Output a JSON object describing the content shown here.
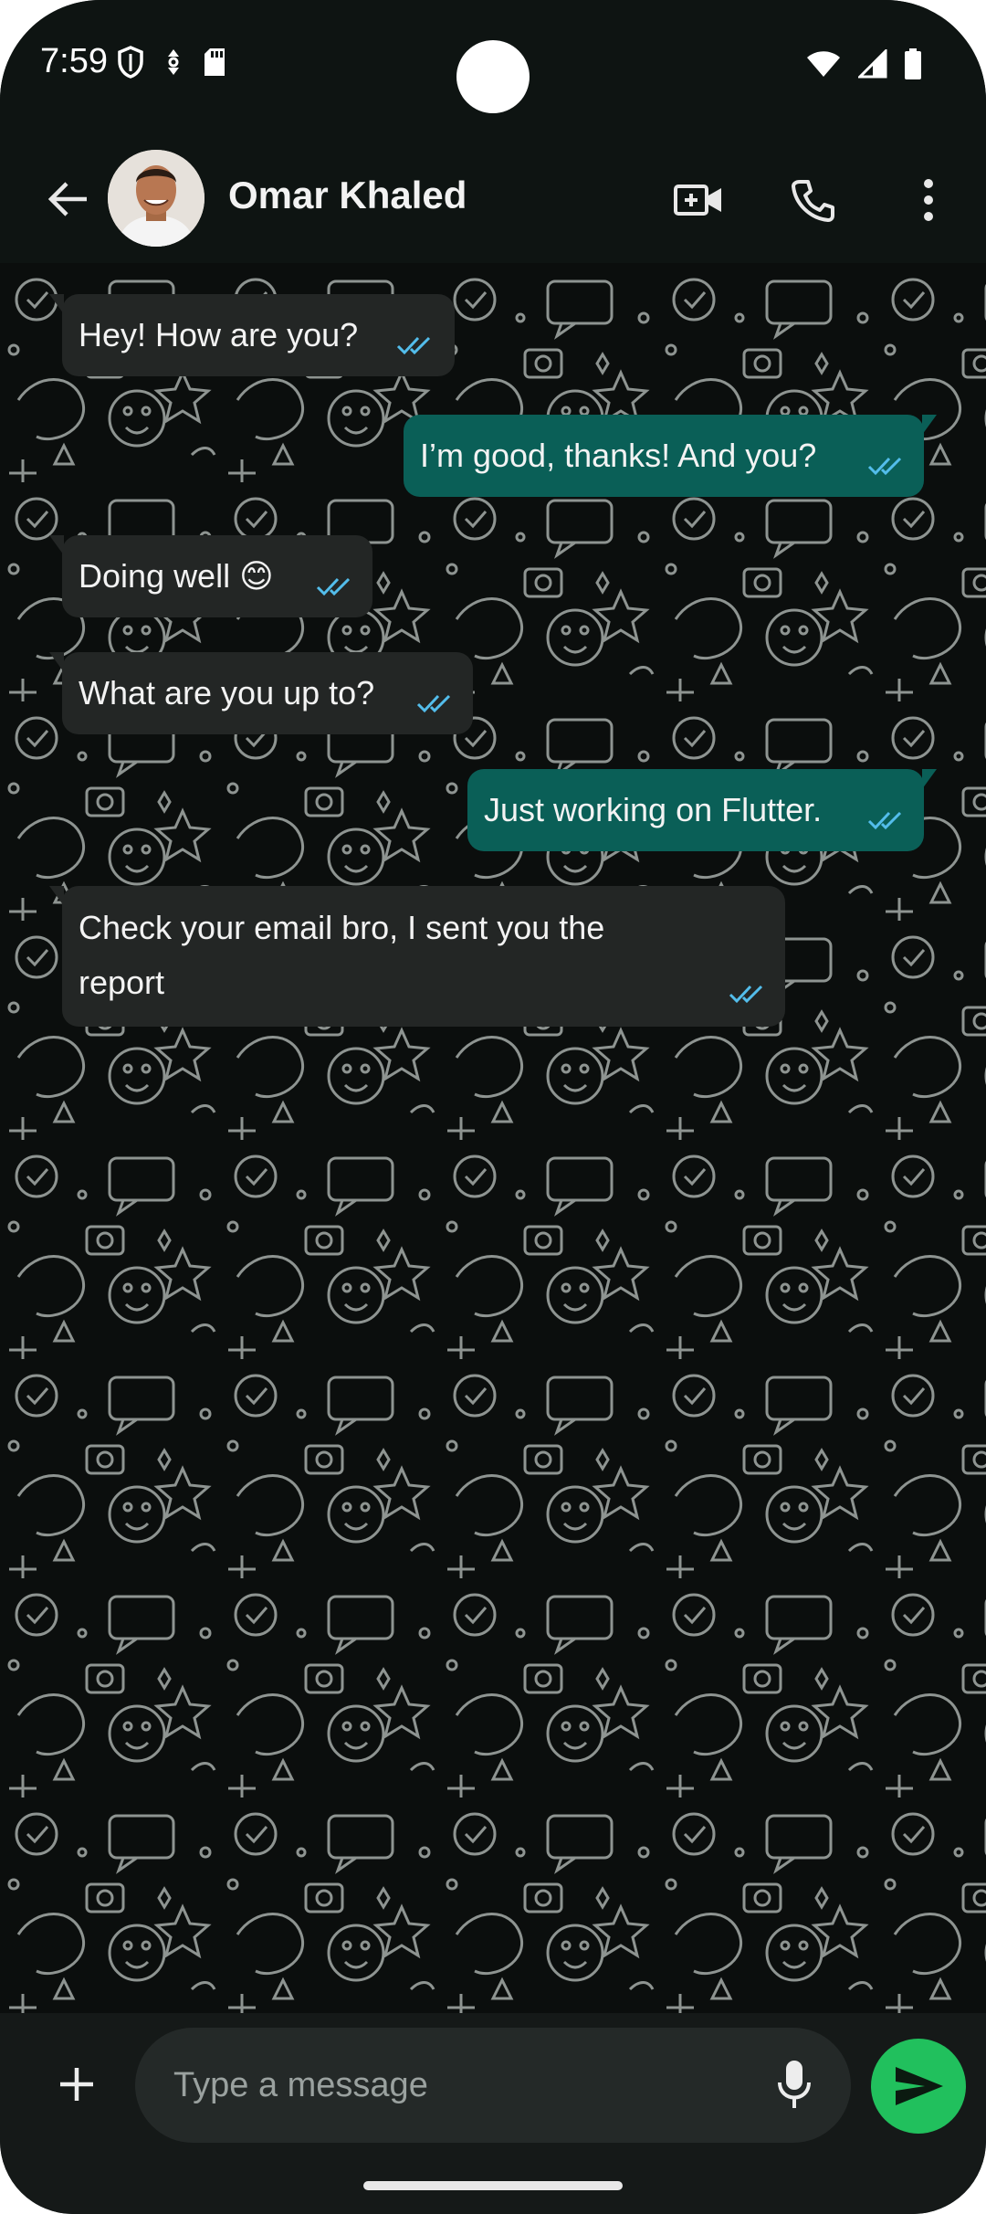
{
  "status_bar": {
    "time": "7:59",
    "left_icons": [
      "shield-icon",
      "data-saver-icon",
      "sd-card-icon"
    ],
    "right_icons": [
      "wifi-icon",
      "signal-icon",
      "battery-icon"
    ]
  },
  "header": {
    "contact_name": "Omar Khaled",
    "actions": [
      "video-call-icon",
      "voice-call-icon",
      "more-vert-icon"
    ]
  },
  "messages": [
    {
      "direction": "incoming",
      "text": "Hey! How are you?",
      "status": "read"
    },
    {
      "direction": "outgoing",
      "text": "I’m good, thanks! And you?",
      "status": "read"
    },
    {
      "direction": "incoming",
      "text": "Doing well 😊",
      "status": "read"
    },
    {
      "direction": "incoming",
      "text": "What are you up to?",
      "status": "read"
    },
    {
      "direction": "outgoing",
      "text": "Just working on Flutter.",
      "status": "read"
    },
    {
      "direction": "incoming",
      "text_line1": " Check your email bro, I sent you the",
      "text_line2": "report",
      "status": "read"
    }
  ],
  "input": {
    "placeholder": "Type a message"
  },
  "colors": {
    "incoming_bubble": "#232625",
    "outgoing_bubble": "#0a5f57",
    "read_ticks": "#53bdeb",
    "send_button": "#21c05d",
    "background": "#0b0e0d"
  }
}
